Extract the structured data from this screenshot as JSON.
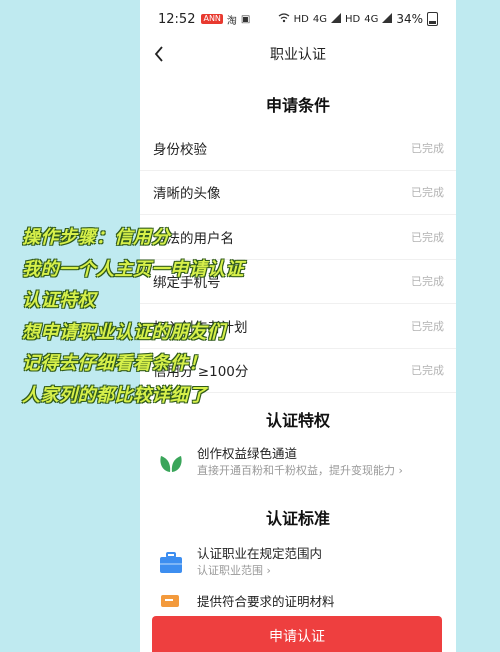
{
  "status_bar": {
    "time": "12:52",
    "badge": "ANN",
    "app_glyph": "淘",
    "net_label": "HD",
    "net_label2": "4G",
    "net_label3": "HD",
    "net_label4": "4G",
    "battery": "34%"
  },
  "nav": {
    "title": "职业认证"
  },
  "requirements": {
    "title": "申请条件",
    "items": [
      {
        "label": "身份校验",
        "status": "已完成"
      },
      {
        "label": "清晰的头像",
        "status": "已完成"
      },
      {
        "label": "合法的用户名",
        "status": "已完成"
      },
      {
        "label": "绑定手机号",
        "status": "已完成"
      },
      {
        "label": "加入创作者计划",
        "status": "已完成"
      },
      {
        "label": "信用分 ≥100分",
        "status": "已完成"
      }
    ]
  },
  "privileges": {
    "title": "认证特权",
    "item": {
      "title": "创作权益绿色通道",
      "desc": "直接开通百粉和千粉权益，提升变现能力 ›"
    }
  },
  "standards": {
    "title": "认证标准",
    "items": [
      {
        "title": "认证职业在规定范围内",
        "desc": "认证职业范围 ›"
      },
      {
        "title": "提供符合要求的证明材料",
        "desc": ""
      }
    ]
  },
  "cta_label": "申请认证",
  "overlay_lines": [
    "操作步骤：信用分",
    "我的一个人主页一申请认证",
    "认证特权",
    "想申请职业认证的朋友们",
    "记得去仔细看看条件！",
    "人家列的都比较详细了"
  ],
  "colors": {
    "accent_red": "#ee3f3f",
    "overlay_text": "#d7f04a",
    "leaf_green": "#3aa55a",
    "briefcase_blue": "#3d8ef0"
  }
}
